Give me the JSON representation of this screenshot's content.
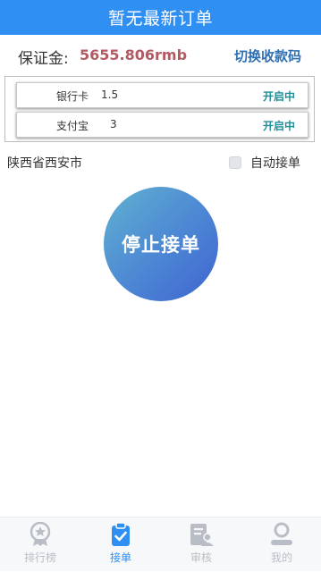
{
  "header": {
    "title": "暂无最新订单"
  },
  "deposit": {
    "label": "保证金:",
    "value": "5655.806rmb",
    "switch_label": "切换收款码"
  },
  "channels": [
    {
      "name": "银行卡",
      "count": "1.5",
      "status": "开启中"
    },
    {
      "name": "支付宝",
      "count": "3",
      "status": "开启中"
    }
  ],
  "location": "陕西省西安市",
  "auto_order": {
    "label": "自动接单",
    "checked": false
  },
  "stop_button": {
    "label": "停止接单"
  },
  "tabbar": {
    "active_tab": "接单",
    "items": [
      {
        "label": "排行榜",
        "icon": "ranking-medal-icon"
      },
      {
        "label": "接单",
        "icon": "clipboard-check-icon"
      },
      {
        "label": "审核",
        "icon": "review-document-icon"
      },
      {
        "label": "我的",
        "icon": "profile-icon"
      }
    ]
  },
  "colors": {
    "header_bg": "#2f8ff2",
    "deposit_value": "#b45a63",
    "link": "#2d6fb5",
    "status_on": "#1f8f9a",
    "tab_active": "#2f8ff2",
    "tab_inactive": "#b9bec6"
  }
}
